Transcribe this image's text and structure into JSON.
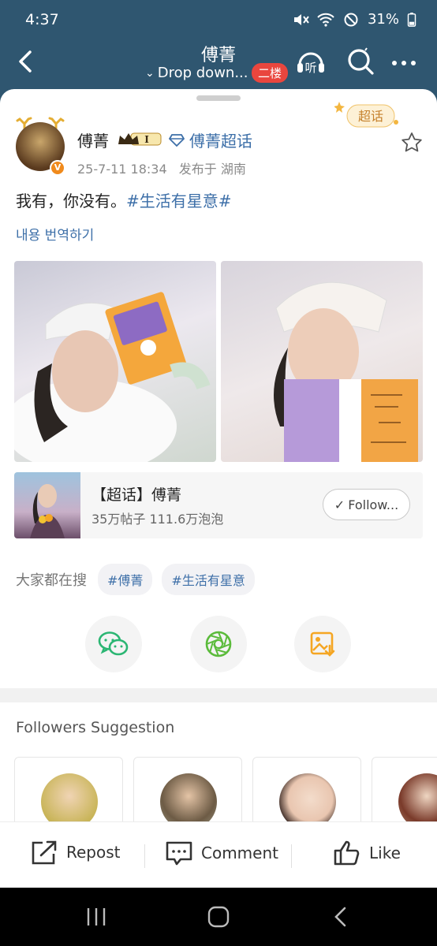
{
  "status_bar": {
    "time": "4:37",
    "battery": "31%"
  },
  "header": {
    "title": "傅菁",
    "subtitle": "Drop down...",
    "floor_badge": "二楼",
    "listen_label": "听"
  },
  "post": {
    "author": "傅菁",
    "level_badge": "I",
    "chaohua_link": "傅菁超话",
    "chaohua_sticker": "超话",
    "timestamp": "25-7-11 18:34",
    "location": "发布于 湖南",
    "text": "我有，你没有。",
    "hashtag": "#生活有星意#",
    "translate": "내용 번역하기",
    "verified_badge": "V"
  },
  "chaohua_card": {
    "title": "【超话】傅菁",
    "stats": "35万帖子 111.6万泡泡",
    "follow_label": "Follow..."
  },
  "search": {
    "label": "大家都在搜",
    "chips": [
      "#傅菁",
      "#生活有星意"
    ]
  },
  "share": {
    "icons": [
      "wechat-icon",
      "moments-icon",
      "save-image-icon"
    ]
  },
  "suggestions": {
    "title": "Followers Suggestion"
  },
  "actions": {
    "repost": "Repost",
    "comment": "Comment",
    "like": "Like"
  },
  "colors": {
    "header_bg": "#2f5670",
    "link": "#3d6fa8",
    "badge_red": "#e9463e",
    "wechat_green": "#2bb673",
    "moments_green": "#5bbb3b",
    "save_orange": "#f5a623"
  }
}
